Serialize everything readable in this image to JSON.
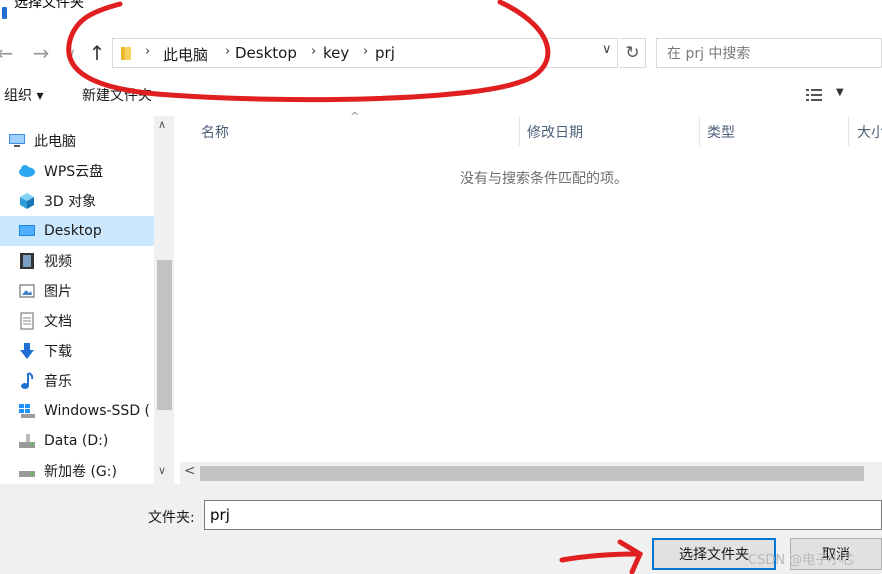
{
  "window": {
    "title": "选择文件夹"
  },
  "nav": {
    "back_glyph": "←",
    "forward_glyph": "→",
    "recent_glyph": "∨",
    "up_glyph": "↑"
  },
  "address": {
    "crumbs": [
      "此电脑",
      "Desktop",
      "key",
      "prj"
    ],
    "separator": "›",
    "dropdown_glyph": "∨",
    "refresh_glyph": "↻"
  },
  "search": {
    "placeholder": "在 prj 中搜索"
  },
  "toolbar": {
    "organize_label": "组织 ▾",
    "new_folder_label": "新建文件夹",
    "view_dropdown_glyph": "▼"
  },
  "sidebar": {
    "items": [
      {
        "label": "此电脑",
        "icon": "computer-icon"
      },
      {
        "label": "WPS云盘",
        "icon": "cloud-icon"
      },
      {
        "label": "3D 对象",
        "icon": "cube-icon"
      },
      {
        "label": "Desktop",
        "icon": "desktop-icon",
        "selected": true
      },
      {
        "label": "视频",
        "icon": "video-icon"
      },
      {
        "label": "图片",
        "icon": "picture-icon"
      },
      {
        "label": "文档",
        "icon": "document-icon"
      },
      {
        "label": "下载",
        "icon": "download-icon"
      },
      {
        "label": "音乐",
        "icon": "music-icon"
      },
      {
        "label": "Windows-SSD (",
        "icon": "windows-drive-icon"
      },
      {
        "label": "Data (D:)",
        "icon": "drive-icon"
      },
      {
        "label": "新加卷 (G:)",
        "icon": "drive-icon"
      }
    ]
  },
  "filelist": {
    "columns": [
      "名称",
      "修改日期",
      "类型",
      "大小"
    ],
    "empty_message": "没有与搜索条件匹配的项。"
  },
  "scroll": {
    "up_glyph": "∧",
    "down_glyph": "∨",
    "left_glyph": "<",
    "sort_glyph": "^"
  },
  "footer": {
    "folder_label": "文件夹:",
    "folder_value": "prj",
    "select_button": "选择文件夹",
    "cancel_button": "取消",
    "watermark": "CSDN @电子小芯"
  },
  "colors": {
    "selection": "#cce8ff",
    "accent": "#0078d7",
    "annotation": "#e02020"
  }
}
